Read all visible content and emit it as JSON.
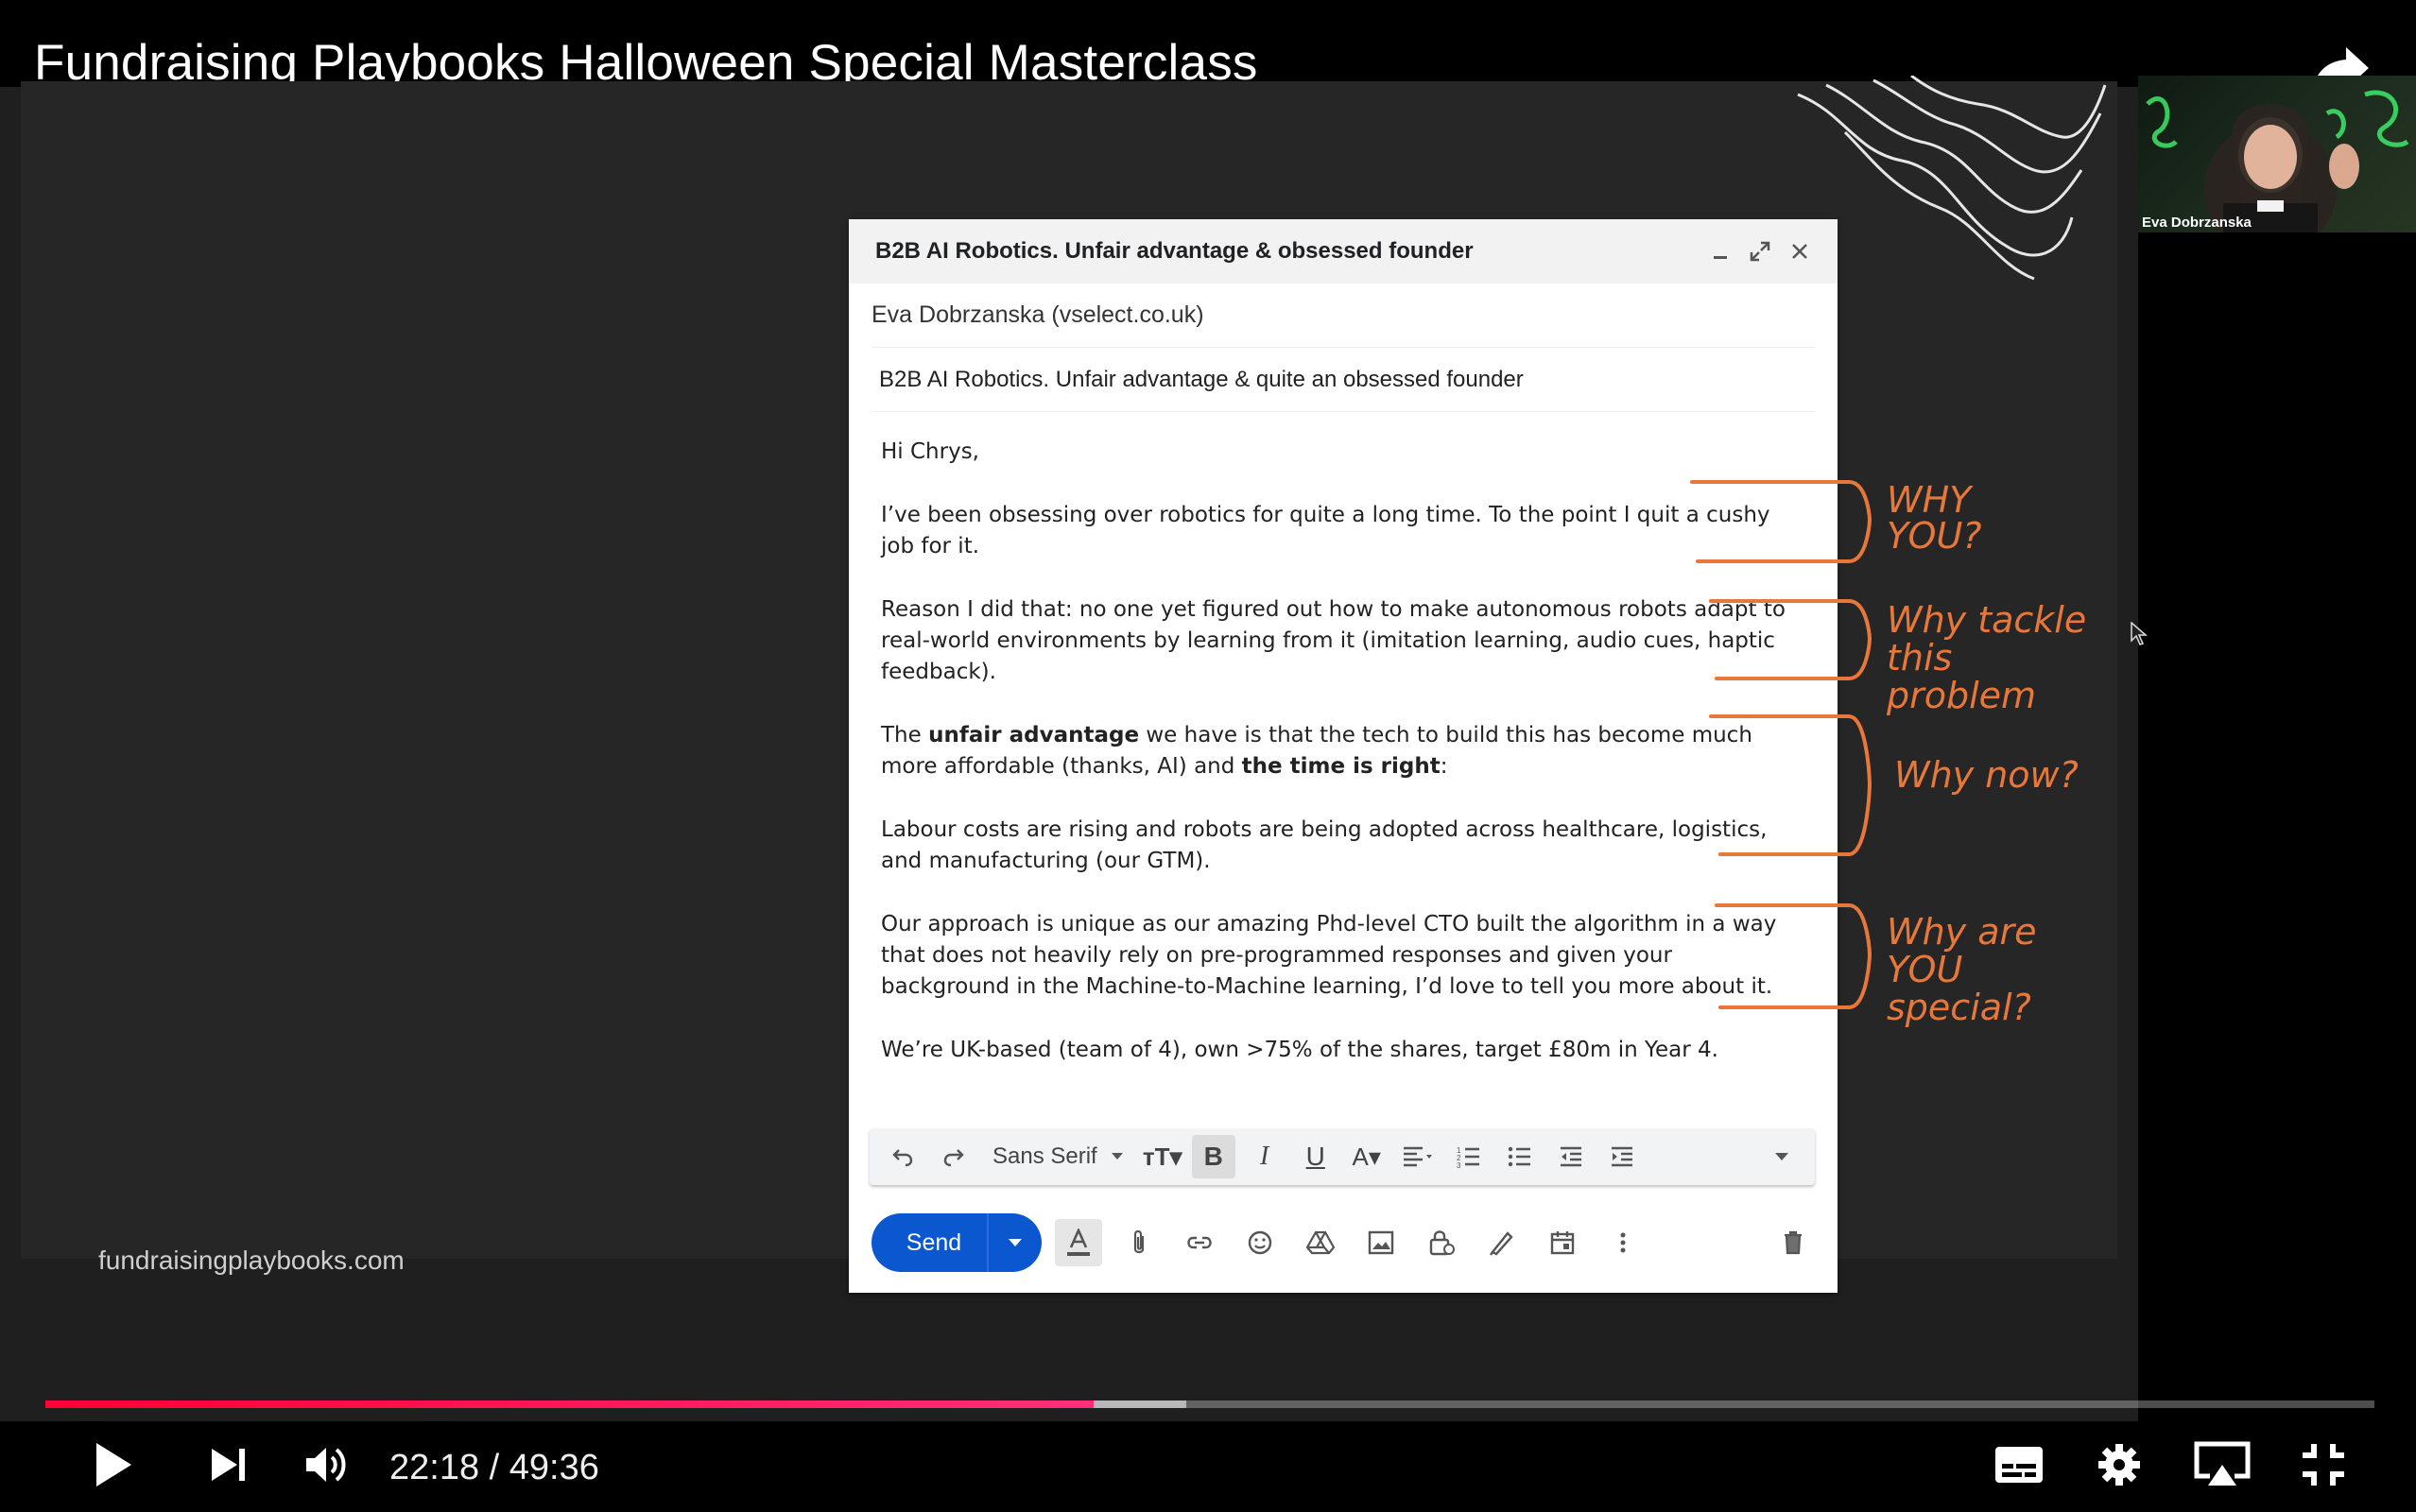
{
  "video": {
    "title": "Fundraising Playbooks Halloween Special Masterclass",
    "site_url": "fundraisingplaybooks.com",
    "webcam_name": "Eva Dobrzanska"
  },
  "email": {
    "window_title": "B2B AI Robotics. Unfair advantage & obsessed founder",
    "from": "Eva Dobrzanska (vselect.co.uk)",
    "subject": "B2B AI Robotics. Unfair advantage & quite an obsessed founder",
    "greeting": "Hi Chrys,",
    "p1": "I’ve been obsessing over robotics for quite a long time. To the point I quit a cushy job for it.",
    "p2": "Reason I did that: no one yet figured out how to make autonomous robots adapt to real-world environments by learning from it (imitation learning, audio cues, haptic feedback).",
    "p3_a": "The ",
    "p3_b": "unfair advantage",
    "p3_c": " we have is that the tech to build this has become much more affordable (thanks, AI) and ",
    "p3_d": "the time is right",
    "p3_e": ":",
    "p4": "Labour costs are rising and robots are being adopted across healthcare, logistics, and manufacturing (our GTM).",
    "p5": "Our approach is unique as our amazing Phd-level CTO built the algorithm in a way that does not heavily rely on pre-programmed responses and given your background in the Machine-to-Machine learning, I’d love to tell you more about it.",
    "p6": "We’re UK-based (team of 4), own >75% of the shares, target £80m in Year 4.",
    "font_select": "Sans Serif",
    "send_label": "Send"
  },
  "annotations": {
    "why_you": "WHY YOU?",
    "why_tackle": "Why tackle this problem",
    "why_now": "Why now?",
    "why_special": "Why are YOU special?"
  },
  "player": {
    "current_time": "22:18",
    "separator": "/",
    "duration": "49:36",
    "progress_fraction": 0.45,
    "buffer_fraction": 0.49,
    "progress_color": "#ff0033",
    "annotation_color": "#e8773a",
    "send_color": "#0b57d0"
  }
}
